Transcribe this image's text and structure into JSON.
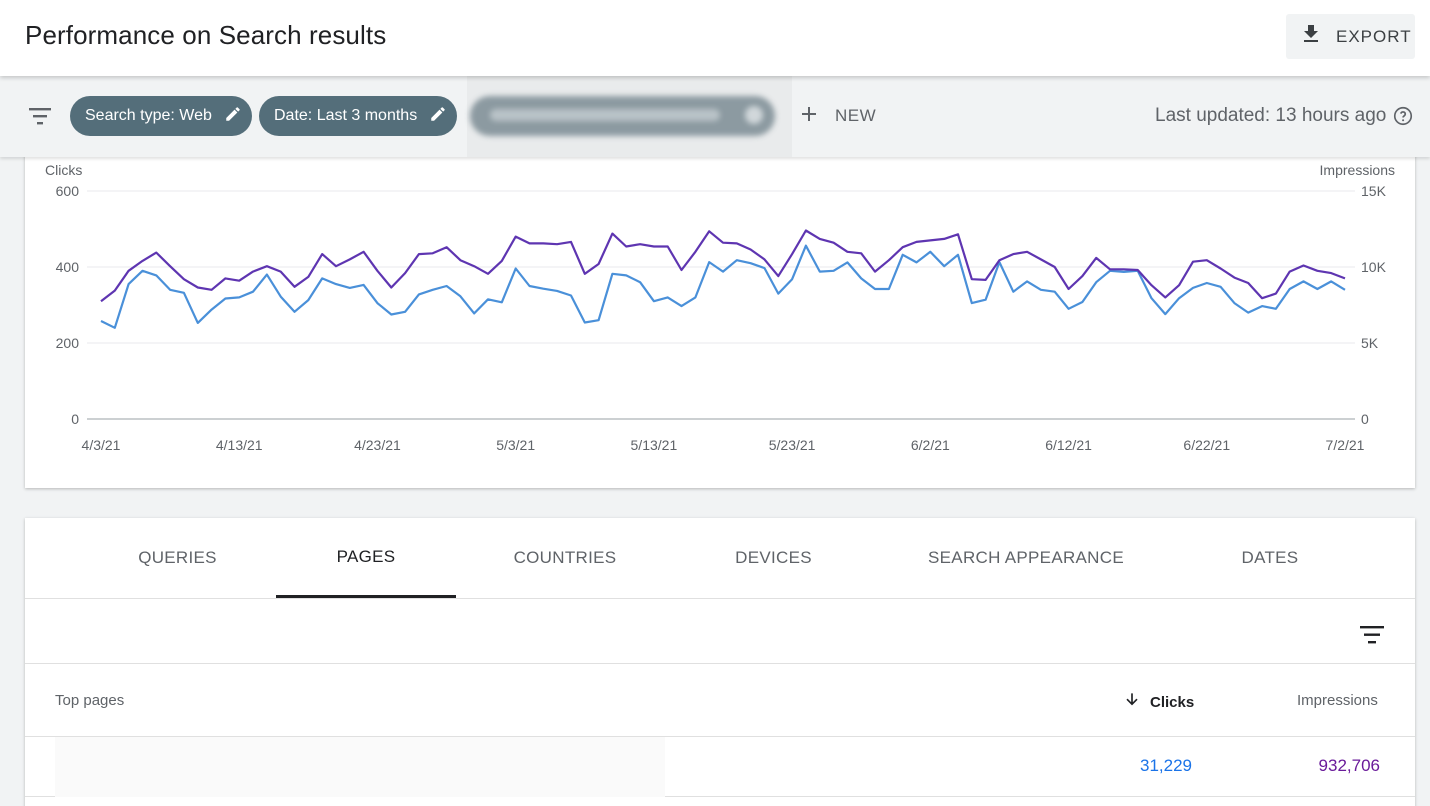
{
  "header": {
    "title": "Performance on Search results",
    "export_label": "EXPORT",
    "export_icon": "download-icon"
  },
  "filters": {
    "chips": [
      {
        "label": "Search type: Web",
        "icon": "pencil-icon"
      },
      {
        "label": "Date: Last 3 months",
        "icon": "pencil-icon"
      }
    ],
    "new_label": "NEW",
    "last_updated": "Last updated: 13 hours ago"
  },
  "chart_data": {
    "type": "line",
    "left_axis_label": "Clicks",
    "right_axis_label": "Impressions",
    "left_ticks": [
      "600",
      "400",
      "200",
      "0"
    ],
    "right_ticks": [
      "15K",
      "10K",
      "5K",
      "0"
    ],
    "left_ylim": [
      0,
      600
    ],
    "right_ylim": [
      0,
      15000
    ],
    "x_tick_labels": [
      "4/3/21",
      "4/13/21",
      "4/23/21",
      "5/3/21",
      "5/13/21",
      "5/23/21",
      "6/2/21",
      "6/12/21",
      "6/22/21",
      "7/2/21"
    ],
    "series": [
      {
        "axis": "left",
        "color": "#4a90d9",
        "values": [
          258,
          240,
          355,
          390,
          378,
          340,
          332,
          253,
          288,
          317,
          320,
          335,
          380,
          322,
          282,
          313,
          370,
          355,
          345,
          353,
          305,
          275,
          282,
          328,
          340,
          350,
          323,
          278,
          315,
          307,
          396,
          350,
          343,
          337,
          325,
          254,
          260,
          382,
          378,
          360,
          310,
          320,
          297,
          320,
          413,
          388,
          418,
          410,
          397,
          330,
          368,
          456,
          388,
          390,
          412,
          370,
          342,
          342,
          432,
          412,
          440,
          402,
          432,
          305,
          314,
          413,
          335,
          362,
          340,
          335,
          290,
          308,
          360,
          390,
          387,
          390,
          318,
          276,
          318,
          345,
          358,
          348,
          305,
          280,
          297,
          290,
          342,
          362,
          342,
          362,
          340
        ]
      },
      {
        "axis": "right",
        "color": "#5e35b1",
        "values": [
          7750,
          8450,
          9750,
          10400,
          10950,
          10050,
          9200,
          8650,
          8500,
          9250,
          9100,
          9700,
          10050,
          9700,
          8700,
          9350,
          10850,
          10050,
          10500,
          11000,
          9750,
          8650,
          9600,
          10850,
          10900,
          11300,
          10450,
          10050,
          9550,
          10400,
          12000,
          11550,
          11550,
          11500,
          11650,
          9550,
          10200,
          12200,
          11350,
          11500,
          11350,
          11350,
          9800,
          11000,
          12350,
          11600,
          11550,
          11150,
          10500,
          9400,
          10850,
          12400,
          11850,
          11600,
          11000,
          10900,
          9700,
          10450,
          11300,
          11650,
          11750,
          11850,
          12150,
          9200,
          9150,
          10450,
          10850,
          11000,
          10500,
          10000,
          8550,
          9400,
          10600,
          9850,
          9850,
          9800,
          8800,
          8000,
          8800,
          10350,
          10450,
          9900,
          9300,
          8950,
          7950,
          8250,
          9700,
          10100,
          9750,
          9600,
          9250
        ]
      }
    ],
    "grid": true
  },
  "tabs": [
    "QUERIES",
    "PAGES",
    "COUNTRIES",
    "DEVICES",
    "SEARCH APPEARANCE",
    "DATES"
  ],
  "active_tab": "PAGES",
  "table": {
    "col_pages": "Top pages",
    "col_clicks": "Clicks",
    "col_impressions": "Impressions",
    "rows": [
      {
        "clicks": "31,229",
        "impressions": "932,706"
      }
    ]
  },
  "colors": {
    "clicks": "#4a90d9",
    "impressions": "#5e35b1",
    "chip_bg": "#546e7a"
  }
}
